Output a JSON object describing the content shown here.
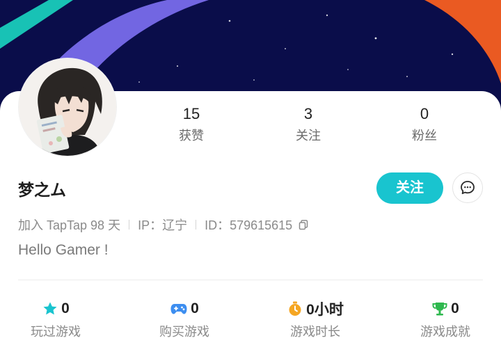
{
  "profile": {
    "username": "梦之ム",
    "bio": "Hello Gamer !"
  },
  "stats": [
    {
      "value": "15",
      "label": "获赞"
    },
    {
      "value": "3",
      "label": "关注"
    },
    {
      "value": "0",
      "label": "粉丝"
    }
  ],
  "actions": {
    "follow_label": "关注"
  },
  "meta": {
    "joined": "加入 TapTap 98 天",
    "ip": "IP：辽宁",
    "id": "ID：579615615"
  },
  "bottom_stats": [
    {
      "value": "0",
      "label": "玩过游戏",
      "icon": "star-icon",
      "color": "#19c4cf"
    },
    {
      "value": "0",
      "label": "购买游戏",
      "icon": "gamepad-icon",
      "color": "#3d8ef0"
    },
    {
      "value": "0小时",
      "label": "游戏时长",
      "icon": "stopwatch-icon",
      "color": "#f5a623"
    },
    {
      "value": "0",
      "label": "游戏成就",
      "icon": "trophy-icon",
      "color": "#2eb84e"
    }
  ],
  "colors": {
    "accent": "#19c4cf",
    "banner_bg": "#0a0d4a"
  }
}
